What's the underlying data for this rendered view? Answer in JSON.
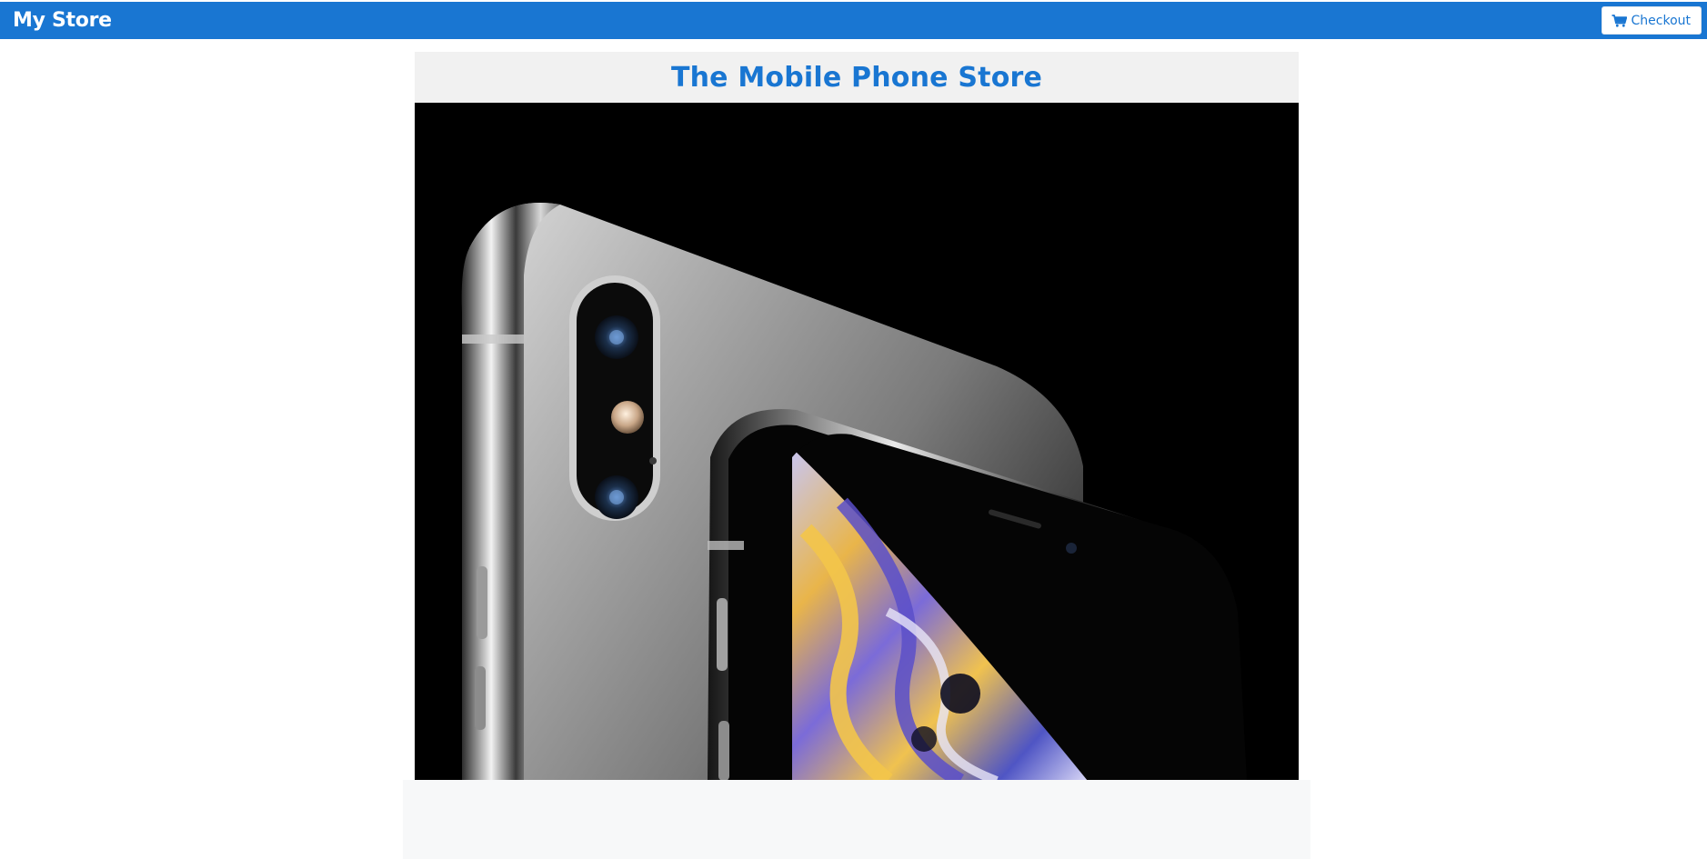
{
  "navbar": {
    "brand": "My Store",
    "checkout_label": "Checkout",
    "checkout_icon": "shopping-cart-icon"
  },
  "header": {
    "title": "The Mobile Phone Store"
  },
  "hero": {
    "subject": "two silver smartphones with dual rear camera and curved display"
  },
  "colors": {
    "primary": "#1976d2",
    "header_bg": "#f1f1f1",
    "hero_bg": "#000000",
    "footer_bg": "#f7f8f9"
  }
}
